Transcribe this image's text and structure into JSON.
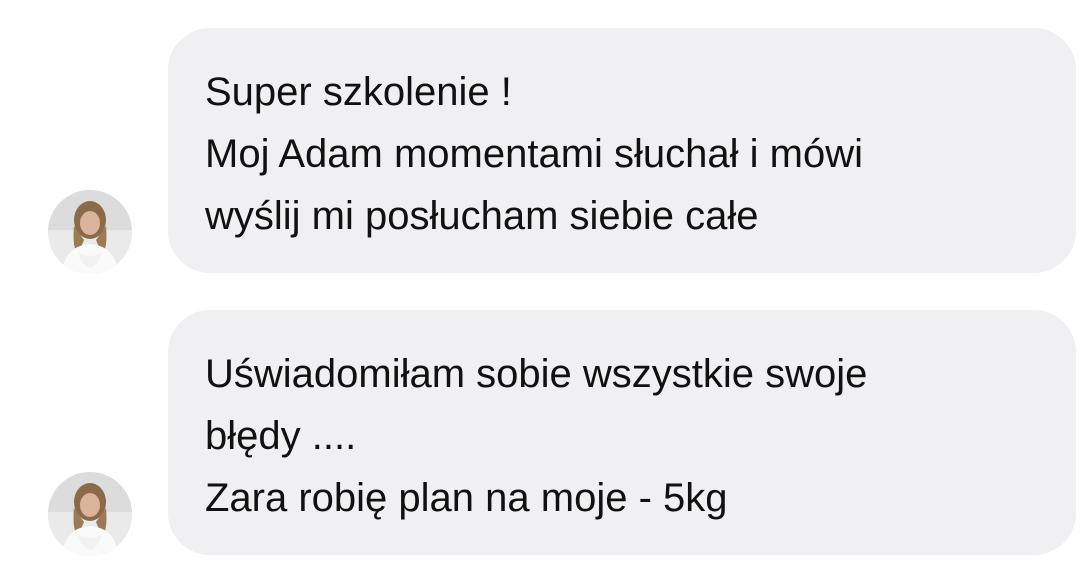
{
  "conversation": {
    "messages": [
      {
        "lines": [
          "Super szkolenie !",
          "Moj Adam momentami słuchał  i mówi",
          "wyślij mi posłucham siebie całe"
        ]
      },
      {
        "lines": [
          "Uświadomiłam sobie wszystkie swoje",
          "błędy ....",
          "Zara robię plan na moje - 5kg"
        ]
      }
    ]
  },
  "colors": {
    "bubble_background": "#f0f0f2",
    "text": "#111111",
    "page_background": "#ffffff"
  }
}
